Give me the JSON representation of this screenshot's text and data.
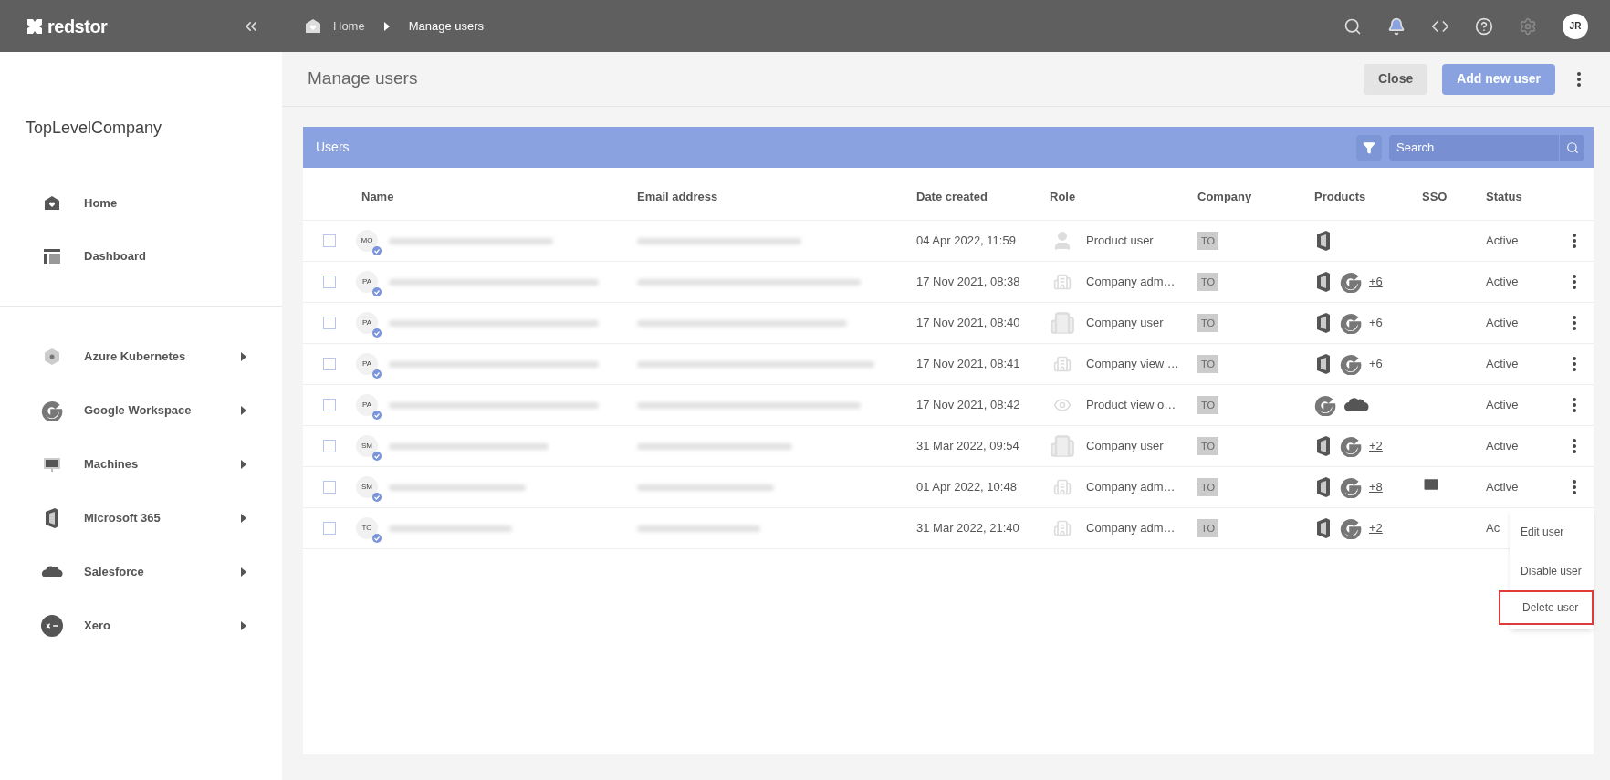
{
  "topbar": {
    "logo": "redstor",
    "breadcrumbs": [
      {
        "label": "Home",
        "kind": "home"
      },
      {
        "label": "Manage users",
        "kind": "current"
      }
    ],
    "avatar": "JR"
  },
  "sidebar": {
    "company": "TopLevelCompany",
    "items": [
      {
        "label": "Home",
        "kind": "home"
      },
      {
        "label": "Dashboard",
        "kind": "dashboard"
      }
    ],
    "products": [
      {
        "label": "Azure Kubernetes",
        "kind": "kubernetes"
      },
      {
        "label": "Google Workspace",
        "kind": "google"
      },
      {
        "label": "Machines",
        "kind": "machine"
      },
      {
        "label": "Microsoft 365",
        "kind": "microsoft"
      },
      {
        "label": "Salesforce",
        "kind": "salesforce"
      },
      {
        "label": "Xero",
        "kind": "xero"
      }
    ]
  },
  "page": {
    "title": "Manage users",
    "buttons": [
      {
        "label": "Close",
        "kind": "secondary"
      },
      {
        "label": "Add new user",
        "kind": "primary"
      }
    ]
  },
  "panel": {
    "title": "Users",
    "search": {
      "placeholder": "Search"
    },
    "columns": [
      "Name",
      "Email address",
      "Date created",
      "Role",
      "Company",
      "Products",
      "SSO",
      "Status"
    ],
    "rows": [
      {
        "initials": "MO",
        "checked": false,
        "date": "04 Apr 2022, 11:59",
        "role": {
          "label": "Product user",
          "kind": "product-user"
        },
        "company": "TO",
        "products": [
          {
            "kind": "microsoft"
          }
        ],
        "sso": false,
        "status": "Active"
      },
      {
        "initials": "PA",
        "checked": false,
        "date": "17 Nov 2021, 08:38",
        "role": {
          "label": "Company adm…",
          "kind": "company-admin"
        },
        "company": "TO",
        "products": [
          {
            "kind": "microsoft"
          },
          {
            "kind": "google"
          },
          {
            "kind": "more",
            "label": "+6"
          }
        ],
        "sso": false,
        "status": "Active"
      },
      {
        "initials": "PA",
        "checked": false,
        "date": "17 Nov 2021, 08:40",
        "role": {
          "label": "Company user",
          "kind": "company-user"
        },
        "company": "TO",
        "products": [
          {
            "kind": "microsoft"
          },
          {
            "kind": "google"
          },
          {
            "kind": "more",
            "label": "+6"
          }
        ],
        "sso": false,
        "status": "Active"
      },
      {
        "initials": "PA",
        "checked": false,
        "date": "17 Nov 2021, 08:41",
        "role": {
          "label": "Company view …",
          "kind": "company-admin"
        },
        "company": "TO",
        "products": [
          {
            "kind": "microsoft"
          },
          {
            "kind": "google"
          },
          {
            "kind": "more",
            "label": "+6"
          }
        ],
        "sso": false,
        "status": "Active"
      },
      {
        "initials": "PA",
        "checked": false,
        "date": "17 Nov 2021, 08:42",
        "role": {
          "label": "Product view o…",
          "kind": "product-viewer"
        },
        "company": "TO",
        "products": [
          {
            "kind": "google"
          },
          {
            "kind": "salesforce"
          }
        ],
        "sso": false,
        "status": "Active"
      },
      {
        "initials": "SM",
        "checked": false,
        "date": "31 Mar 2022, 09:54",
        "role": {
          "label": "Company user",
          "kind": "company-user"
        },
        "company": "TO",
        "products": [
          {
            "kind": "microsoft"
          },
          {
            "kind": "google"
          },
          {
            "kind": "more",
            "label": "+2"
          }
        ],
        "sso": false,
        "status": "Active"
      },
      {
        "initials": "SM",
        "checked": false,
        "date": "01 Apr 2022, 10:48",
        "role": {
          "label": "Company adm…",
          "kind": "company-admin"
        },
        "company": "TO",
        "products": [
          {
            "kind": "microsoft"
          },
          {
            "kind": "google"
          },
          {
            "kind": "more",
            "label": "+8"
          }
        ],
        "sso": true,
        "status": "Active"
      },
      {
        "initials": "TO",
        "checked": false,
        "date": "31 Mar 2022, 21:40",
        "role": {
          "label": "Company adm…",
          "kind": "company-admin"
        },
        "company": "TO",
        "products": [
          {
            "kind": "microsoft"
          },
          {
            "kind": "google"
          },
          {
            "kind": "more",
            "label": "+2"
          }
        ],
        "sso": false,
        "status": "Ac"
      }
    ],
    "menu": [
      {
        "label": "Edit user",
        "highlighted": false
      },
      {
        "label": "Disable user",
        "highlighted": false
      },
      {
        "label": "Delete user",
        "highlighted": true
      }
    ]
  }
}
